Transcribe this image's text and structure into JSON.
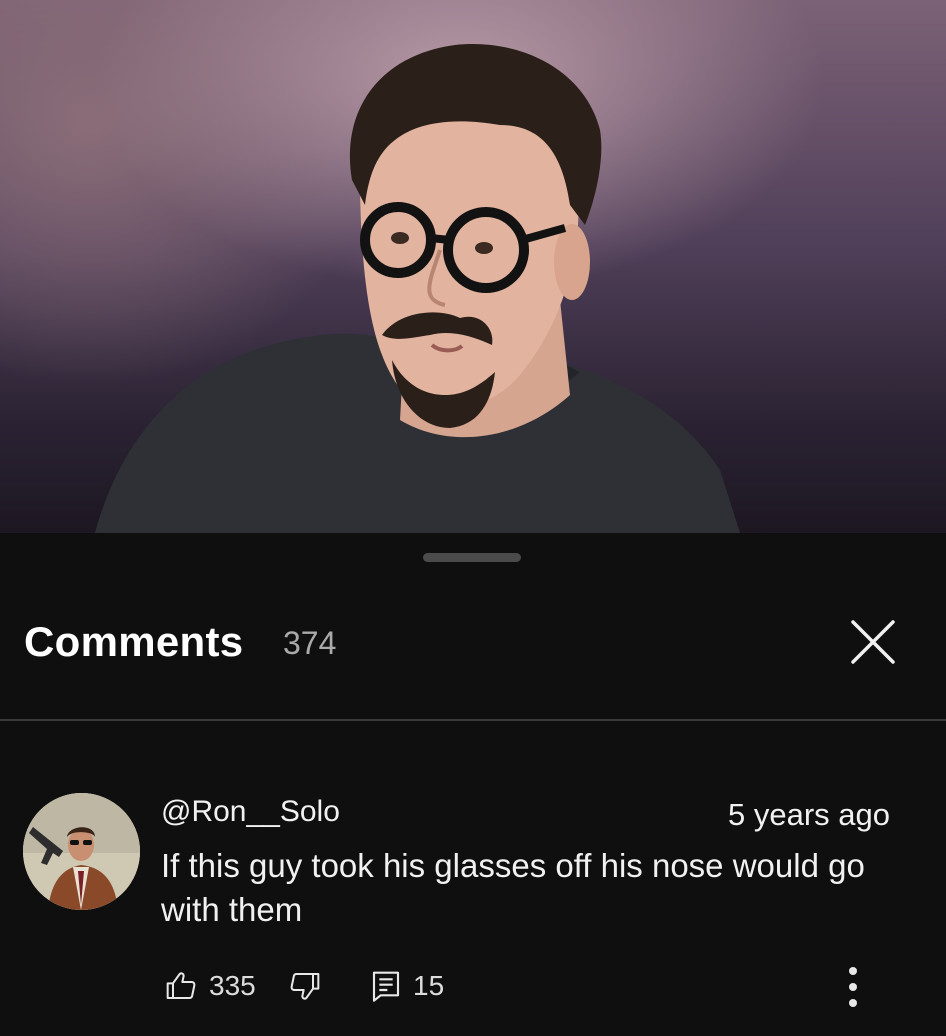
{
  "video": {
    "description_icon": "person-video-frame"
  },
  "comments_panel": {
    "title": "Comments",
    "count": "374",
    "close_icon": "close-icon"
  },
  "comment": {
    "author": "@Ron__Solo",
    "timestamp": "5 years ago",
    "text": "If this guy took his glasses off his nose would go with them",
    "likes": "335",
    "replies": "15",
    "icons": {
      "like": "thumbs-up-icon",
      "dislike": "thumbs-down-icon",
      "reply": "reply-icon",
      "more": "more-vert-icon"
    }
  },
  "colors": {
    "background": "#0f0f0f",
    "text_primary": "#f1f1f1",
    "text_secondary": "#aaaaaa",
    "divider": "#3a3a3a"
  }
}
